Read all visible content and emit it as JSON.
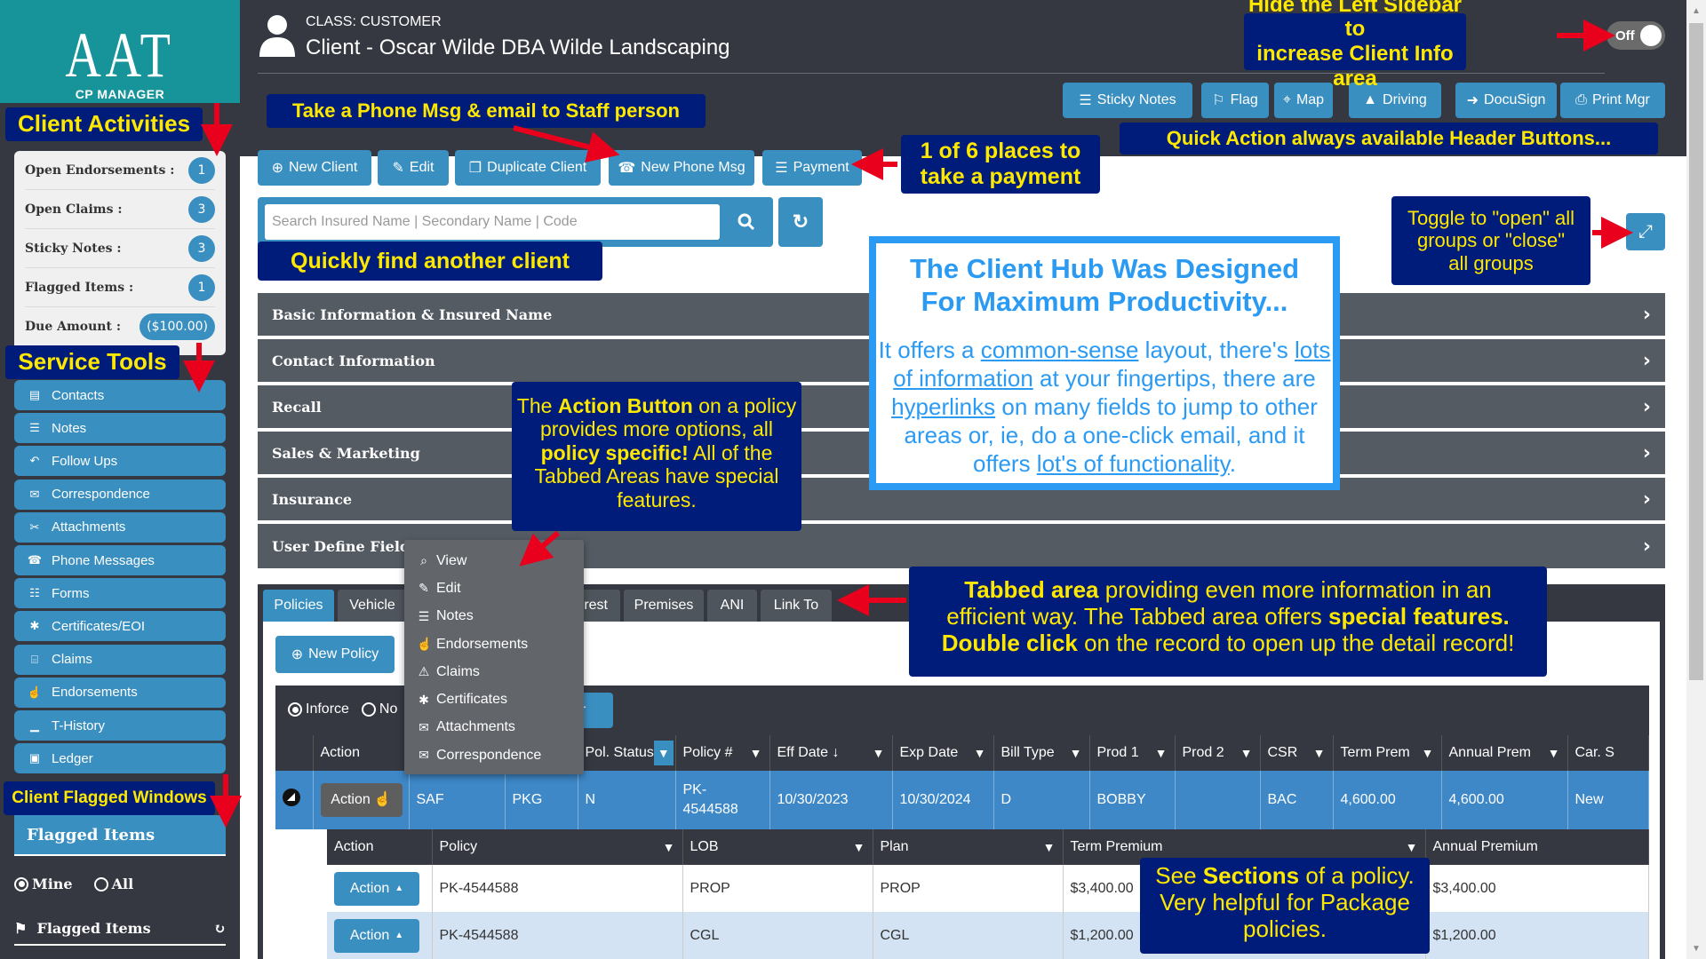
{
  "logo": {
    "big": "AAT",
    "small": "CP MANAGER"
  },
  "sidebar": {
    "activities": [
      {
        "label": "Open Endorsements :",
        "value": "1"
      },
      {
        "label": "Open Claims :",
        "value": "3"
      },
      {
        "label": "Sticky Notes :",
        "value": "3"
      },
      {
        "label": "Flagged Items :",
        "value": "1"
      },
      {
        "label": "Due Amount :",
        "value": "($100.00)"
      }
    ],
    "service_tools": [
      {
        "label": "Contacts",
        "icon": "book-icon"
      },
      {
        "label": "Notes",
        "icon": "file-icon"
      },
      {
        "label": "Follow Ups",
        "icon": "reply-icon"
      },
      {
        "label": "Correspondence",
        "icon": "comments-icon"
      },
      {
        "label": "Attachments",
        "icon": "paperclip-icon"
      },
      {
        "label": "Phone Messages",
        "icon": "phone-icon"
      },
      {
        "label": "Forms",
        "icon": "file-text-icon"
      },
      {
        "label": "Certificates/EOI",
        "icon": "certificate-icon"
      },
      {
        "label": "Claims",
        "icon": "list-alt-icon"
      },
      {
        "label": "Endorsements",
        "icon": "thumbs-up-icon"
      },
      {
        "label": "T-History",
        "icon": "bar-chart-icon"
      },
      {
        "label": "Ledger",
        "icon": "money-icon"
      }
    ],
    "flagged_header": "Flagged Items",
    "radio_mine": "Mine",
    "radio_all": "All",
    "flagged_list_title": "Flagged Items"
  },
  "header": {
    "class_label": "CLASS: CUSTOMER",
    "client_title": "Client - Oscar Wilde DBA Wilde Landscaping",
    "toggle_label": "Off",
    "buttons": [
      {
        "label": "Sticky Notes",
        "icon": "☰"
      },
      {
        "label": "Flag",
        "icon": "⚐"
      },
      {
        "label": "Map",
        "icon": "⌖"
      },
      {
        "label": "Driving",
        "icon": "▲"
      },
      {
        "label": "DocuSign",
        "icon": "➜"
      },
      {
        "label": "Print Mgr",
        "icon": "⎙"
      }
    ]
  },
  "toolbar": {
    "buttons": [
      {
        "label": "New Client",
        "icon": "⊕"
      },
      {
        "label": "Edit",
        "icon": "✎"
      },
      {
        "label": "Duplicate Client",
        "icon": "❐"
      },
      {
        "label": "New Phone Msg",
        "icon": "☎"
      },
      {
        "label": "Payment",
        "icon": "☰"
      }
    ],
    "search_placeholder": "Search Insured Name | Secondary Name | Code",
    "search_value": ""
  },
  "accordion": [
    "Basic Information & Insured Name",
    "Contact Information",
    "Recall",
    "Sales & Marketing",
    "Insurance",
    "User Define Fields"
  ],
  "tabs": [
    "Policies",
    "Vehicle",
    "rest",
    "Premises",
    "ANI",
    "Link To"
  ],
  "policies": {
    "new_policy_label": "New Policy",
    "radio_inforce": "Inforce",
    "radio_not": "No",
    "filter_btn_text": "r",
    "columns": [
      "",
      "Action",
      "",
      "",
      "Pol. Status",
      "Policy #",
      "Eff Date",
      "Exp Date",
      "Bill Type",
      "Prod 1",
      "Prod 2",
      "CSR",
      "Term Prem",
      "Annual Prem",
      "Car. S"
    ],
    "rows": [
      {
        "action": "Action",
        "c1": "SAF",
        "c2": "PKG",
        "status": "N",
        "policy": "PK-\n4544588",
        "eff": "10/30/2023",
        "exp": "10/30/2024",
        "bill": "D",
        "prod1": "BOBBY",
        "prod2": "",
        "csr": "BAC",
        "term": "4,600.00",
        "annual": "4,600.00",
        "car": "New"
      }
    ]
  },
  "action_menu": [
    {
      "label": "View",
      "icon": "⌕"
    },
    {
      "label": "Edit",
      "icon": "✎"
    },
    {
      "label": "Notes",
      "icon": "☰"
    },
    {
      "label": "Endorsements",
      "icon": "☝"
    },
    {
      "label": "Claims",
      "icon": "⚠"
    },
    {
      "label": "Certificates",
      "icon": "✱"
    },
    {
      "label": "Attachments",
      "icon": "✉"
    },
    {
      "label": "Correspondence",
      "icon": "✉"
    }
  ],
  "sections": {
    "columns": [
      "Action",
      "Policy",
      "LOB",
      "Plan",
      "Term Premium",
      "Annual Premium"
    ],
    "rows": [
      {
        "action": "Action",
        "policy": "PK-4544588",
        "lob": "PROP",
        "plan": "PROP",
        "term": "$3,400.00",
        "annual": "$3,400.00"
      },
      {
        "action": "Action",
        "policy": "PK-4544588",
        "lob": "CGL",
        "plan": "CGL",
        "term": "$1,200.00",
        "annual": "$1,200.00"
      }
    ]
  },
  "annotations": {
    "client_activities": "Client Activities",
    "service_tools": "Service Tools",
    "client_flagged_windows": "Client Flagged Windows",
    "phone_msg": "Take a Phone Msg & email to Staff person",
    "hide_sidebar_1": "Hide the Left Sidebar to",
    "hide_sidebar_2": "increase Client Info area",
    "quick_action": "Quick Action always available Header Buttons...",
    "payment_1": "1 of 6 places to",
    "payment_2": "take a payment",
    "find_client": "Quickly find another client",
    "toggle_groups_1": "Toggle to \"open\" all",
    "toggle_groups_2": "groups or \"close\"",
    "toggle_groups_3": "all groups",
    "hub_title_1": "The Client Hub Was Designed",
    "hub_title_2": "For Maximum Productivity...",
    "hub_p1": "It offers a ",
    "hub_l1": "common-sense",
    "hub_p2": " layout, there's ",
    "hub_l2": "lots of information",
    "hub_p3": " at your fingertips, there are ",
    "hub_l3": "hyperlinks",
    "hub_p4": " on many fields to jump to other areas or, ie, do a one-click email, and it offers ",
    "hub_l4": "lot's of functionality",
    "hub_p5": ".",
    "action_btn_a": "The ",
    "action_btn_b": "Action Button",
    "action_btn_c": " on a policy provides more options, all ",
    "action_btn_d": "policy specific!",
    "action_btn_e": " All of the Tabbed Areas have special features.",
    "tabbed_a": "Tabbed area",
    "tabbed_b": " providing even more information in an efficient way. The Tabbed area offers ",
    "tabbed_c": "special features.",
    "tabbed_d": "Double click",
    "tabbed_e": " on the record to open up the detail record!",
    "sections_a": "See ",
    "sections_b": "Sections",
    "sections_c": " of a policy. Very helpful for Package policies."
  },
  "colors": {
    "brand_teal": "#17939a",
    "accent_blue": "#3a8fc1",
    "dark_bg": "#353841",
    "annotation_bg": "#001c7a",
    "annotation_text": "#ffe800",
    "hub_blue": "#2b9af3"
  }
}
